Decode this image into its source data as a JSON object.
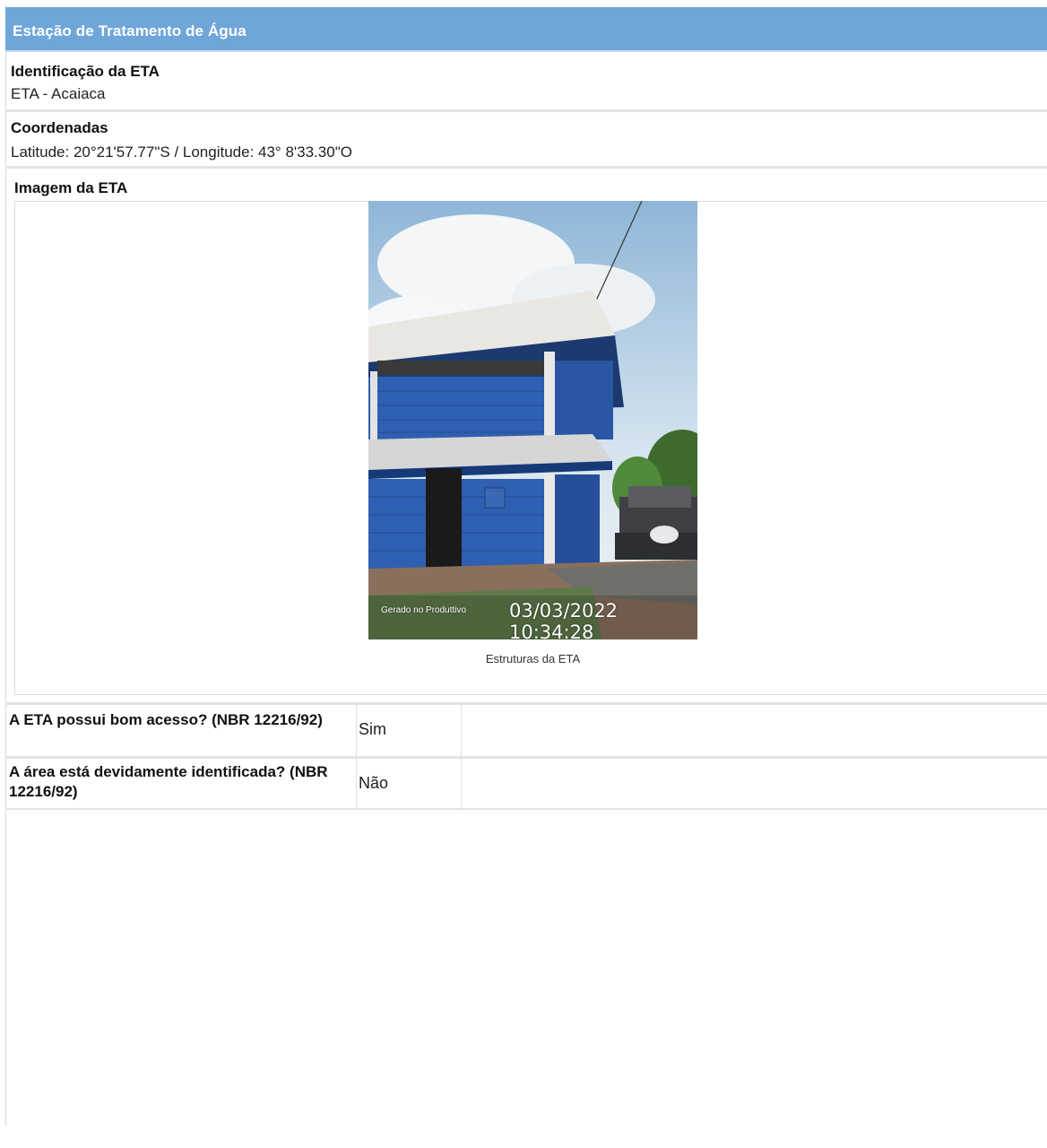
{
  "header": {
    "title": "Estação de Tratamento de Água"
  },
  "identification": {
    "label": "Identificação da ETA",
    "value": "ETA - Acaiaca"
  },
  "coordinates": {
    "label": "Coordenadas",
    "value": "Latitude: 20°21'57.77\"S / Longitude: 43° 8'33.30\"O"
  },
  "image_section": {
    "label": "Imagem da ETA",
    "photo_stamp_label": "Gerado no Produttivo",
    "photo_stamp_time": "03/03/2022 10:34:28",
    "caption": "Estruturas da ETA"
  },
  "questions": [
    {
      "text": "A ETA possui bom acesso? (NBR 12216/92)",
      "answer": "Sim"
    },
    {
      "text": "A área está devidamente identificada? (NBR 12216/92)",
      "answer": "Não"
    }
  ],
  "colors": {
    "header_bg": "#6fa6d9",
    "wall_blue": "#2f5fb0"
  }
}
